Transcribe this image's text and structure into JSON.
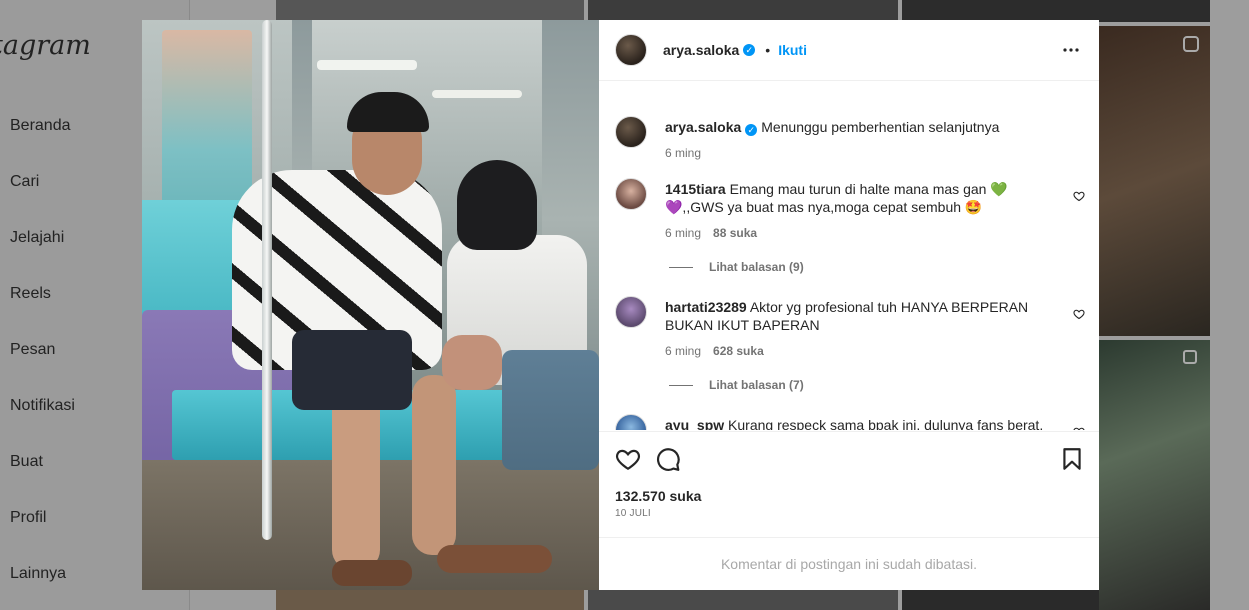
{
  "background": {
    "logo": "tagram",
    "nav": [
      "Beranda",
      "Cari",
      "Jelajahi",
      "Reels",
      "Pesan",
      "Notifikasi",
      "Buat",
      "Profil",
      "Lainnya"
    ]
  },
  "post": {
    "author": "arya.saloka",
    "follow_label": "Ikuti",
    "separator": "•",
    "verified_mark": "✓",
    "caption": {
      "username": "arya.saloka",
      "text": "Menunggu pemberhentian selanjutnya",
      "time": "6 ming"
    },
    "comments": [
      {
        "username": "1415tiara",
        "text": "Emang mau turun di halte mana mas gan 💚 💜,,GWS ya buat mas nya,moga cepat sembuh 🤩",
        "time": "6 ming",
        "likes": "88 suka",
        "replies": "Lihat balasan (9)"
      },
      {
        "username": "hartati23289",
        "text": "Aktor yg profesional tuh HANYA BERPERAN BUKAN IKUT BAPERAN",
        "time": "6 ming",
        "likes": "628 suka",
        "replies": "Lihat balasan (7)"
      },
      {
        "username": "ayu_spw",
        "text": "Kurang respeck sama bpak ini, dulunya fans berat, tapi stelah kesini tros ag jadi ilfil sama kamu mas Arya, syg istri",
        "time": "",
        "likes": "",
        "replies": ""
      }
    ],
    "likes_total": "132.570 suka",
    "date": "10 JULI",
    "comments_limited": "Komentar di postingan ini sudah dibatasi."
  },
  "icons": {
    "more": "more-options-icon",
    "heart": "heart-icon",
    "comment": "comment-icon",
    "save": "bookmark-icon"
  }
}
